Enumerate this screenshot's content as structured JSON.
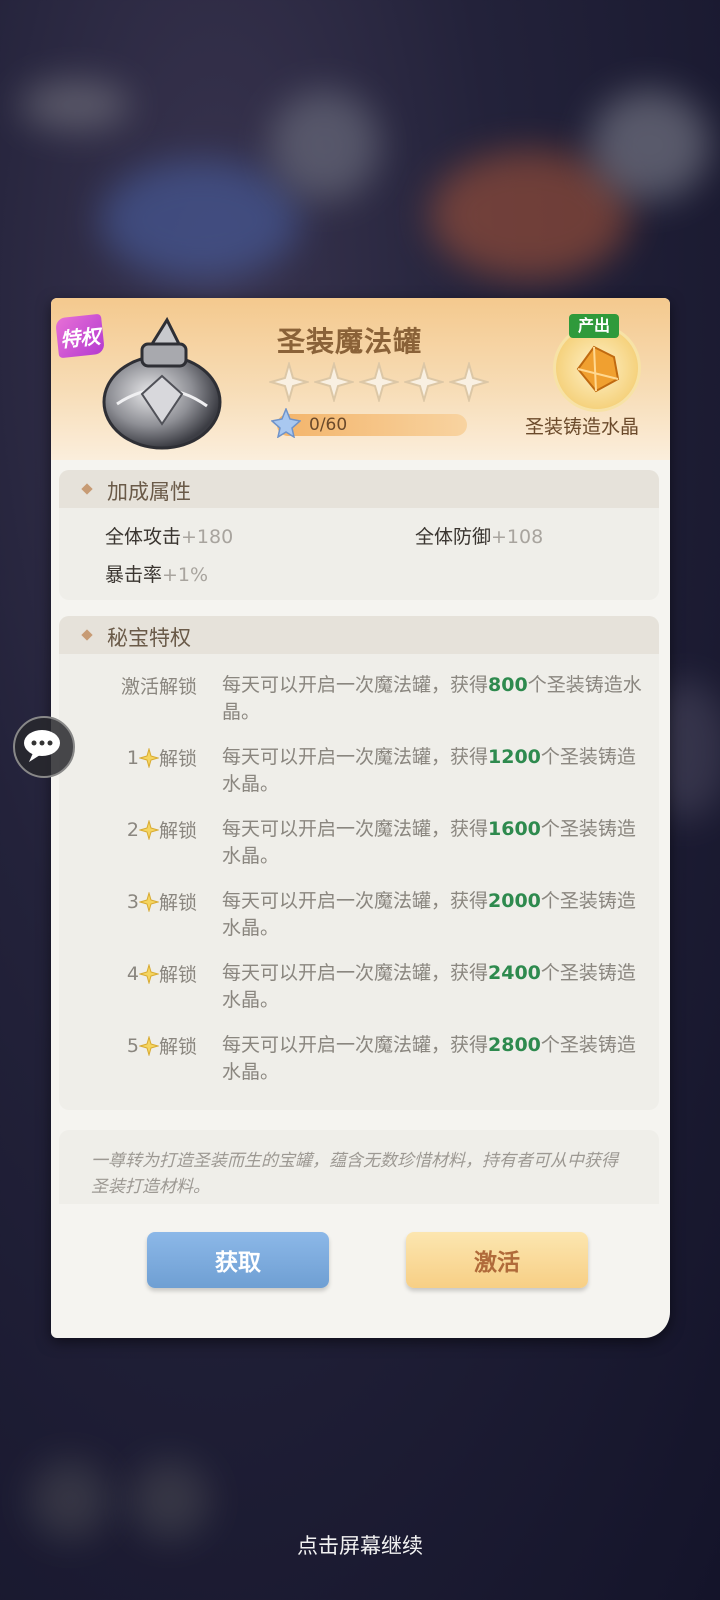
{
  "item": {
    "badge": "特权",
    "title": "圣装魔法罐",
    "stars_filled": 0,
    "stars_total": 5,
    "progress_text": "0/60",
    "output_tag": "产出",
    "output_name": "圣装铸造水晶"
  },
  "attributes": {
    "section_title": "加成属性",
    "items": [
      {
        "label": "全体攻击",
        "value": "+180"
      },
      {
        "label": "全体防御",
        "value": "+108"
      },
      {
        "label": "暴击率",
        "value": "+1%"
      }
    ]
  },
  "privileges": {
    "section_title": "秘宝特权",
    "rows": [
      {
        "level": "",
        "unlock": "激活解锁",
        "text_before": "每天可以开启一次魔法罐，获得",
        "amount": "800",
        "text_after": "个圣装铸造水晶。"
      },
      {
        "level": "1",
        "unlock": "解锁",
        "text_before": "每天可以开启一次魔法罐，获得",
        "amount": "1200",
        "text_after": "个圣装铸造水晶。"
      },
      {
        "level": "2",
        "unlock": "解锁",
        "text_before": "每天可以开启一次魔法罐，获得",
        "amount": "1600",
        "text_after": "个圣装铸造水晶。"
      },
      {
        "level": "3",
        "unlock": "解锁",
        "text_before": "每天可以开启一次魔法罐，获得",
        "amount": "2000",
        "text_after": "个圣装铸造水晶。"
      },
      {
        "level": "4",
        "unlock": "解锁",
        "text_before": "每天可以开启一次魔法罐，获得",
        "amount": "2400",
        "text_after": "个圣装铸造水晶。"
      },
      {
        "level": "5",
        "unlock": "解锁",
        "text_before": "每天可以开启一次魔法罐，获得",
        "amount": "2800",
        "text_after": "个圣装铸造水晶。"
      }
    ]
  },
  "description": "一尊转为打造圣装而生的宝罐，蕴含无数珍惜材料，持有者可从中获得圣装打造材料。",
  "buttons": {
    "get": "获取",
    "activate": "激活"
  },
  "footer": {
    "continue_hint": "点击屏幕继续"
  },
  "colors": {
    "header_gold": "#f4c98e",
    "amount_green": "#2e8a4e",
    "get_button_blue": "#7faad9",
    "activate_button_gold": "#f9d998",
    "badge_purple": "#c64fd4",
    "output_tag_green": "#2f9a3b"
  },
  "icons": {
    "badge": "privilege-badge",
    "jar": "magic-jar-icon",
    "star": "empty-star-icon",
    "progress": "blue-star-icon",
    "output": "crystal-icon",
    "level": "sparkle-star-icon",
    "chat": "chat-bubble-icon"
  }
}
